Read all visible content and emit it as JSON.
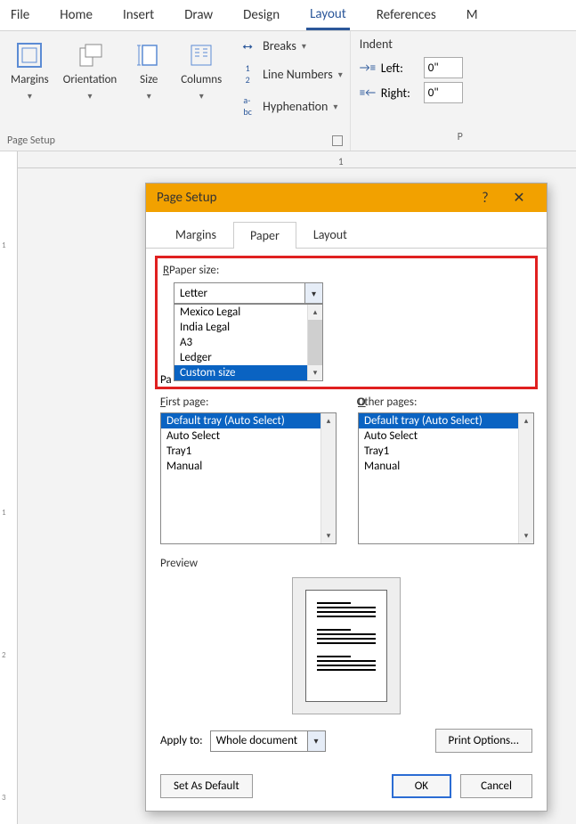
{
  "ribbon_tabs": [
    "File",
    "Home",
    "Insert",
    "Draw",
    "Design",
    "Layout",
    "References",
    "M"
  ],
  "ribbon_active_tab": "Layout",
  "page_setup_group": {
    "margins": "Margins",
    "orientation": "Orientation",
    "size": "Size",
    "columns": "Columns",
    "breaks": "Breaks",
    "line_numbers": "Line Numbers",
    "hyphenation": "Hyphenation",
    "label": "Page Setup"
  },
  "indent": {
    "title": "Indent",
    "left_label": "Left:",
    "left_value": "0\"",
    "right_label": "Right:",
    "right_value": "0\"",
    "group_label_partial": "P"
  },
  "dialog": {
    "title": "Page Setup",
    "help": "?",
    "close": "✕",
    "tabs": {
      "margins": "Margins",
      "paper": "Paper",
      "layout": "Layout"
    },
    "paper_size_label": "Paper size:",
    "paper_size_value": "Letter",
    "paper_options": [
      "Mexico Legal",
      "India Legal",
      "A3",
      "Ledger",
      "Custom size"
    ],
    "paper_selected_option": "Custom size",
    "paper_source_label_partial": "Pa",
    "first_page_label": "First page:",
    "other_pages_label": "Other pages:",
    "tray_options": [
      "Default tray (Auto Select)",
      "Auto Select",
      "Tray1",
      "Manual"
    ],
    "tray_selected": "Default tray (Auto Select)",
    "preview_label": "Preview",
    "apply_to_label": "Apply to:",
    "apply_to_value": "Whole document",
    "print_options": "Print Options...",
    "set_default": "Set As Default",
    "ok": "OK",
    "cancel": "Cancel"
  },
  "ruler": {
    "mark": "1"
  }
}
